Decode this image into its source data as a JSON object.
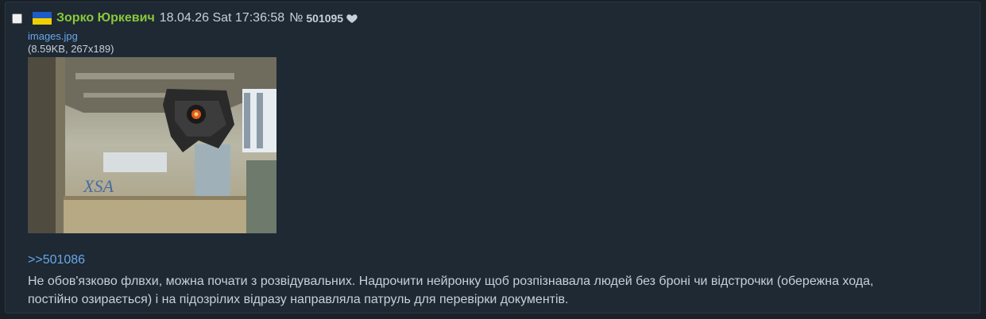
{
  "post": {
    "flag_icon": "ukraine-flag-icon",
    "flag_colors": {
      "top": "#1d5bc7",
      "bottom": "#f1d000"
    },
    "name": "Зорко Юркевич",
    "date": "18.04.26 Sat 17:36:58",
    "number_label": "№",
    "number": "501095",
    "favorite_icon": "heart-icon",
    "file": {
      "name": "images.jpg",
      "meta": "(8.59KB, 267x189)"
    },
    "reply_link": ">>501086",
    "body_lines": [
      "Не обов'язково флвхи, можна почати з розвідувальних. Надрочити нейронку щоб розпізнавала людей без броні чи відстрочки (обережна хода,",
      "постійно озирається) і на підозрілих відразу направляла патруль для перевірки документів."
    ]
  },
  "colors": {
    "background": "#192027",
    "post_background": "#1e2934",
    "name_color": "#89c93a",
    "link_color": "#6aa6e8",
    "text_color": "#c6d0d8"
  }
}
